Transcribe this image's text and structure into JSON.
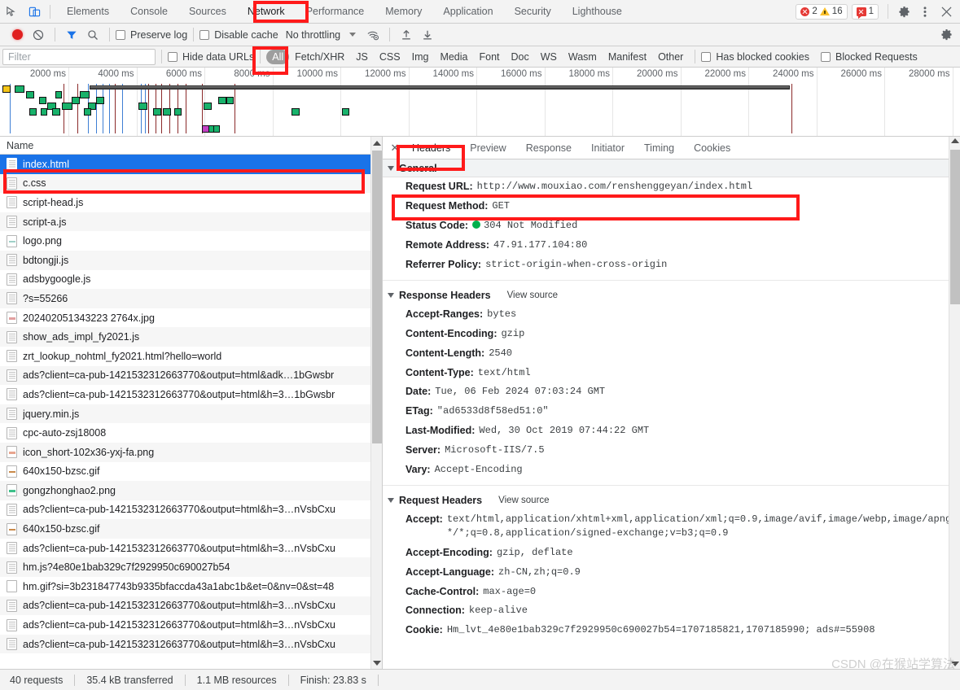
{
  "devtools": {
    "main_tabs": [
      {
        "label": "Elements",
        "active": false
      },
      {
        "label": "Console",
        "active": false
      },
      {
        "label": "Sources",
        "active": false
      },
      {
        "label": "Network",
        "active": true
      },
      {
        "label": "Performance",
        "active": false
      },
      {
        "label": "Memory",
        "active": false
      },
      {
        "label": "Application",
        "active": false
      },
      {
        "label": "Security",
        "active": false
      },
      {
        "label": "Lighthouse",
        "active": false
      }
    ],
    "counters": {
      "errors": "2",
      "warnings": "16",
      "messages": "1"
    }
  },
  "network_toolbar": {
    "preserve_log_label": "Preserve log",
    "disable_cache_label": "Disable cache",
    "throttling_value": "No throttling"
  },
  "filter_bar": {
    "filter_placeholder": "Filter",
    "filter_value": "",
    "hide_data_urls_label": "Hide data URLs",
    "types": [
      {
        "label": "All",
        "active": true
      },
      {
        "label": "Fetch/XHR",
        "active": false
      },
      {
        "label": "JS",
        "active": false
      },
      {
        "label": "CSS",
        "active": false
      },
      {
        "label": "Img",
        "active": false
      },
      {
        "label": "Media",
        "active": false
      },
      {
        "label": "Font",
        "active": false
      },
      {
        "label": "Doc",
        "active": false
      },
      {
        "label": "WS",
        "active": false
      },
      {
        "label": "Wasm",
        "active": false
      },
      {
        "label": "Manifest",
        "active": false
      },
      {
        "label": "Other",
        "active": false
      }
    ],
    "has_blocked_cookies_label": "Has blocked cookies",
    "blocked_requests_label": "Blocked Requests"
  },
  "overview": {
    "ticks": [
      "2000 ms",
      "4000 ms",
      "6000 ms",
      "8000 ms",
      "10000 ms",
      "12000 ms",
      "14000 ms",
      "16000 ms",
      "18000 ms",
      "20000 ms",
      "22000 ms",
      "24000 ms",
      "26000 ms",
      "28000 ms"
    ]
  },
  "request_list": {
    "column_header": "Name",
    "rows": [
      {
        "name": "index.html",
        "type": "doc",
        "selected": true
      },
      {
        "name": "c.css",
        "type": "doc",
        "selected": false
      },
      {
        "name": "script-head.js",
        "type": "doc",
        "selected": false
      },
      {
        "name": "script-a.js",
        "type": "doc",
        "selected": false
      },
      {
        "name": "logo.png",
        "type": "img",
        "color": "#9fd0c8",
        "selected": false
      },
      {
        "name": "bdtongji.js",
        "type": "doc",
        "selected": false
      },
      {
        "name": "adsbygoogle.js",
        "type": "doc",
        "selected": false
      },
      {
        "name": "?s=55266",
        "type": "doc",
        "selected": false
      },
      {
        "name": "202402051343223 2764x.jpg",
        "type": "img",
        "color": "#e2a0a0",
        "selected": false
      },
      {
        "name": "show_ads_impl_fy2021.js",
        "type": "doc",
        "selected": false
      },
      {
        "name": "zrt_lookup_nohtml_fy2021.html?hello=world",
        "type": "doc",
        "selected": false
      },
      {
        "name": "ads?client=ca-pub-1421532312663770&output=html&adk…1bGwsbr",
        "type": "doc",
        "selected": false
      },
      {
        "name": "ads?client=ca-pub-1421532312663770&output=html&h=3…1bGwsbr",
        "type": "doc",
        "selected": false
      },
      {
        "name": "jquery.min.js",
        "type": "doc",
        "selected": false
      },
      {
        "name": "cpc-auto-zsj18008",
        "type": "doc",
        "selected": false
      },
      {
        "name": "icon_short-102x36-yxj-fa.png",
        "type": "img",
        "color": "#e8a58f",
        "selected": false
      },
      {
        "name": "640x150-bzsc.gif",
        "type": "img",
        "color": "#c98a4a",
        "selected": false
      },
      {
        "name": "gongzhonghao2.png",
        "type": "img",
        "color": "#3ec08a",
        "selected": false
      },
      {
        "name": "ads?client=ca-pub-1421532312663770&output=html&h=3…nVsbCxu",
        "type": "doc",
        "selected": false
      },
      {
        "name": "640x150-bzsc.gif",
        "type": "img",
        "color": "#c98a4a",
        "selected": false
      },
      {
        "name": "ads?client=ca-pub-1421532312663770&output=html&h=3…nVsbCxu",
        "type": "doc",
        "selected": false
      },
      {
        "name": "hm.js?4e80e1bab329c7f2929950c690027b54",
        "type": "doc",
        "selected": false
      },
      {
        "name": "hm.gif?si=3b231847743b9335bfaccda43a1abc1b&et=0&nv=0&st=48",
        "type": "blank",
        "selected": false
      },
      {
        "name": "ads?client=ca-pub-1421532312663770&output=html&h=3…nVsbCxu",
        "type": "doc",
        "selected": false
      },
      {
        "name": "ads?client=ca-pub-1421532312663770&output=html&h=3…nVsbCxu",
        "type": "doc",
        "selected": false
      },
      {
        "name": "ads?client=ca-pub-1421532312663770&output=html&h=3…nVsbCxu",
        "type": "doc",
        "selected": false
      }
    ]
  },
  "detail_tabs": [
    {
      "label": "Headers",
      "active": true
    },
    {
      "label": "Preview",
      "active": false
    },
    {
      "label": "Response",
      "active": false
    },
    {
      "label": "Initiator",
      "active": false
    },
    {
      "label": "Timing",
      "active": false
    },
    {
      "label": "Cookies",
      "active": false
    }
  ],
  "details": {
    "general": {
      "title": "General",
      "items": [
        {
          "key": "Request URL:",
          "value": "http://www.mouxiao.com/renshenggeyan/index.html",
          "highlight": true
        },
        {
          "key": "Request Method:",
          "value": "GET"
        },
        {
          "key": "Status Code:",
          "value": "304 Not Modified",
          "status_dot": true
        },
        {
          "key": "Remote Address:",
          "value": "47.91.177.104:80"
        },
        {
          "key": "Referrer Policy:",
          "value": "strict-origin-when-cross-origin"
        }
      ]
    },
    "response_headers": {
      "title": "Response Headers",
      "view_source": "View source",
      "items": [
        {
          "key": "Accept-Ranges:",
          "value": "bytes"
        },
        {
          "key": "Content-Encoding:",
          "value": "gzip"
        },
        {
          "key": "Content-Length:",
          "value": "2540"
        },
        {
          "key": "Content-Type:",
          "value": "text/html"
        },
        {
          "key": "Date:",
          "value": "Tue, 06 Feb 2024 07:03:24 GMT"
        },
        {
          "key": "ETag:",
          "value": "\"ad6533d8f58ed51:0\""
        },
        {
          "key": "Last-Modified:",
          "value": "Wed, 30 Oct 2019 07:44:22 GMT"
        },
        {
          "key": "Server:",
          "value": "Microsoft-IIS/7.5"
        },
        {
          "key": "Vary:",
          "value": "Accept-Encoding"
        }
      ]
    },
    "request_headers": {
      "title": "Request Headers",
      "view_source": "View source",
      "items": [
        {
          "key": "Accept:",
          "value": "text/html,application/xhtml+xml,application/xml;q=0.9,image/avif,image/webp,image/apng,*/*;q=0.8,application/signed-exchange;v=b3;q=0.9",
          "wrap": true
        },
        {
          "key": "Accept-Encoding:",
          "value": "gzip, deflate"
        },
        {
          "key": "Accept-Language:",
          "value": "zh-CN,zh;q=0.9"
        },
        {
          "key": "Cache-Control:",
          "value": "max-age=0"
        },
        {
          "key": "Connection:",
          "value": "keep-alive"
        },
        {
          "key": "Cookie:",
          "value": "Hm_lvt_4e80e1bab329c7f2929950c690027b54=1707185821,1707185990; ads#=55908"
        }
      ]
    }
  },
  "status_bar": {
    "requests": "40 requests",
    "transferred": "35.4 kB transferred",
    "resources": "1.1 MB resources",
    "finish": "Finish: 23.83 s"
  },
  "watermark": "CSDN @在猴站学算法"
}
